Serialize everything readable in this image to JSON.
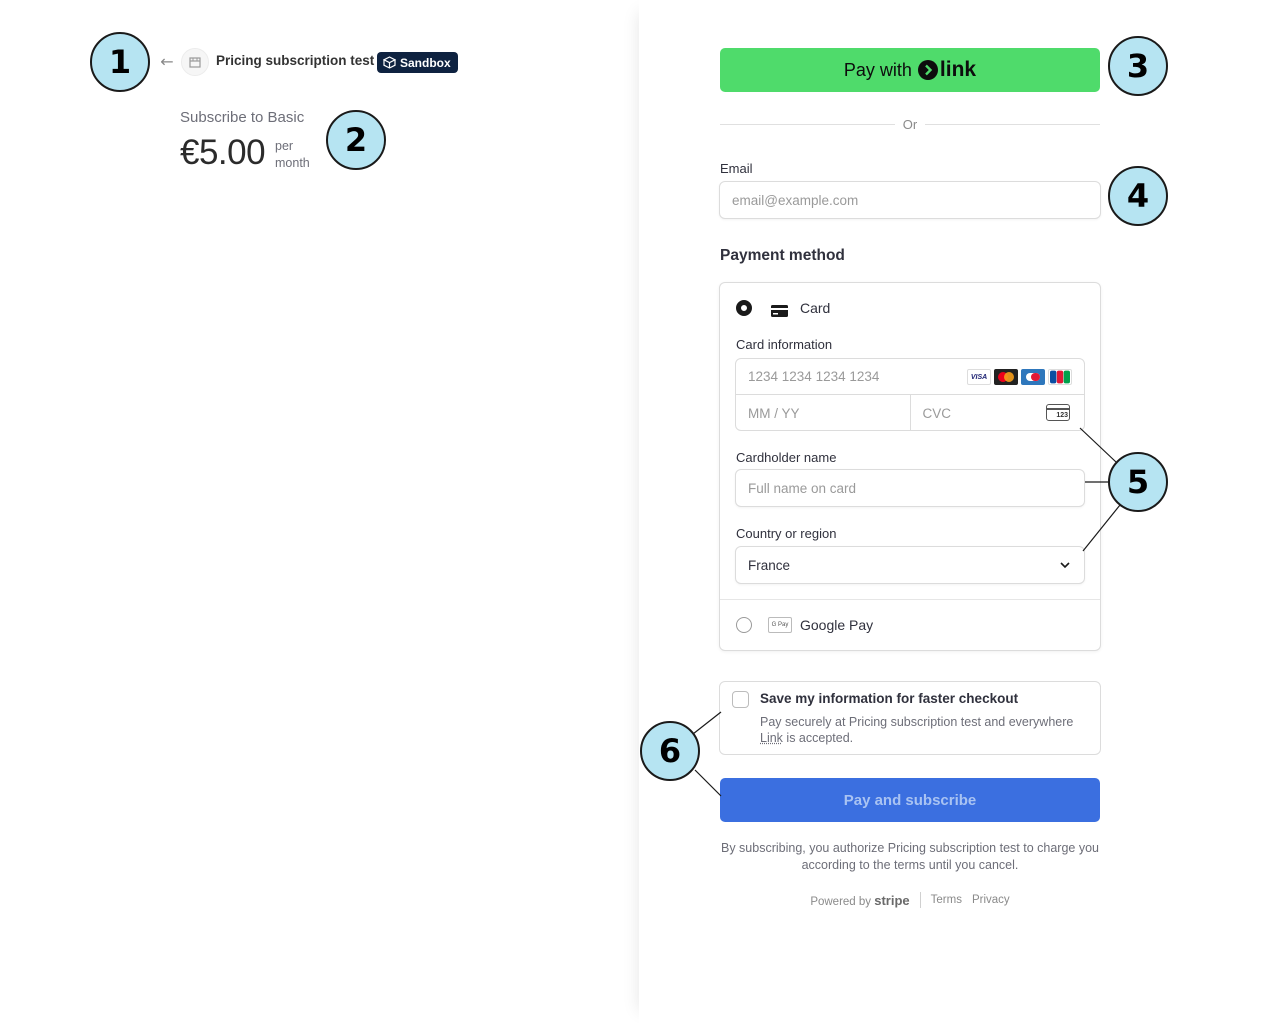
{
  "header": {
    "business_name": "Pricing subscription test",
    "sandbox_label": "Sandbox"
  },
  "summary": {
    "subscribe_label": "Subscribe to Basic",
    "price": "€5.00",
    "per": "per",
    "period": "month"
  },
  "link_button": {
    "prefix": "Pay with",
    "brand": "link"
  },
  "divider_text": "Or",
  "email": {
    "label": "Email",
    "placeholder": "email@example.com"
  },
  "payment": {
    "title": "Payment method",
    "card_label": "Card",
    "card_info_label": "Card information",
    "card_number_placeholder": "1234 1234 1234 1234",
    "expiry_placeholder": "MM / YY",
    "cvc_placeholder": "CVC",
    "cvc_icon_text": "123",
    "brands": [
      "VISA",
      "MC",
      "AMEX",
      "JCB"
    ],
    "cardholder_label": "Cardholder name",
    "cardholder_placeholder": "Full name on card",
    "country_label": "Country or region",
    "country_value": "France",
    "google_pay_label": "Google Pay",
    "google_pay_icon_text": "G Pay"
  },
  "save_info": {
    "title": "Save my information for faster checkout",
    "desc_before": "Pay securely at Pricing subscription test and everywhere ",
    "link_word": "Link",
    "desc_after": " is accepted."
  },
  "pay_button_label": "Pay and subscribe",
  "terms": "By subscribing, you authorize Pricing subscription test to charge you according to the terms until you cancel.",
  "footer": {
    "powered_by": "Powered by",
    "stripe": "stripe",
    "terms": "Terms",
    "privacy": "Privacy"
  },
  "callouts": [
    "1",
    "2",
    "3",
    "4",
    "5",
    "6"
  ],
  "colors": {
    "link_green": "#4fdb6b",
    "pay_blue": "#3b6fe0",
    "callout_fill": "#b6e4f2",
    "sandbox_navy": "#0e2240"
  }
}
